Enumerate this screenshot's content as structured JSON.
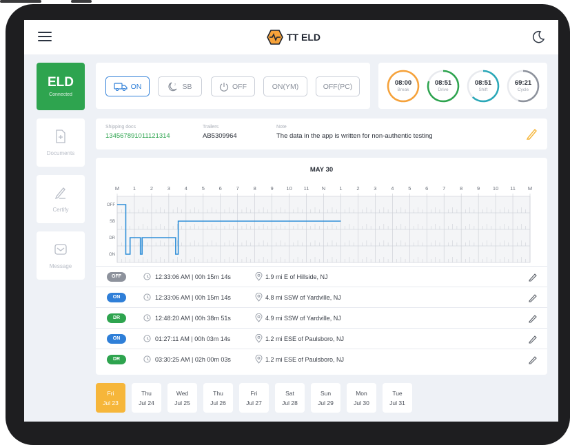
{
  "app": {
    "title": "TT ELD"
  },
  "colors": {
    "accent": "#2f7fd8",
    "green": "#2ea44f",
    "orange": "#f6a23a",
    "teal": "#2aa8b8",
    "gray": "#8d929c"
  },
  "eld": {
    "label": "ELD",
    "status": "Connected"
  },
  "sidebar": {
    "items": [
      {
        "label": "Documents",
        "icon": "document-plus-icon"
      },
      {
        "label": "Certify",
        "icon": "pen-icon"
      },
      {
        "label": "Message",
        "icon": "envelope-icon"
      }
    ]
  },
  "status_buttons": [
    {
      "label": "ON",
      "icon": "truck-icon",
      "active": true
    },
    {
      "label": "SB",
      "icon": "sleep-icon",
      "active": false
    },
    {
      "label": "OFF",
      "icon": "power-icon",
      "active": false
    },
    {
      "label": "ON(YM)",
      "active": false
    },
    {
      "label": "OFF(PC)",
      "active": false
    }
  ],
  "timers": [
    {
      "value": "08:00",
      "label": "Break",
      "color": "#f6a23a",
      "progress": 1.0
    },
    {
      "value": "08:51",
      "label": "Drive",
      "color": "#2ea44f",
      "progress": 0.8
    },
    {
      "value": "08:51",
      "label": "Shift",
      "color": "#2aa8b8",
      "progress": 0.62
    },
    {
      "value": "69:21",
      "label": "Cycle",
      "color": "#8d929c",
      "progress": 0.55
    }
  ],
  "info": {
    "shipping_label": "Shipping docs",
    "shipping_value": "134567891011121314",
    "trailers_label": "Trailers",
    "trailers_value": "AB5309964",
    "note_label": "Note",
    "note_value": "The data in the app is written for non-authentic testing"
  },
  "log": {
    "date": "MAY 30",
    "hour_labels": [
      "M",
      "1",
      "2",
      "3",
      "4",
      "5",
      "6",
      "7",
      "8",
      "9",
      "10",
      "11",
      "N",
      "1",
      "2",
      "3",
      "4",
      "5",
      "6",
      "7",
      "8",
      "9",
      "10",
      "11",
      "M"
    ],
    "status_labels": [
      "OFF",
      "SB",
      "DR",
      "ON"
    ],
    "segments": [
      {
        "status": "OFF",
        "start": 0.0,
        "end": 0.5
      },
      {
        "status": "ON",
        "start": 0.5,
        "end": 0.75
      },
      {
        "status": "DR",
        "start": 0.75,
        "end": 1.35
      },
      {
        "status": "ON",
        "start": 1.35,
        "end": 1.45
      },
      {
        "status": "DR",
        "start": 1.45,
        "end": 3.4
      },
      {
        "status": "ON",
        "start": 3.4,
        "end": 3.55
      },
      {
        "status": "SB",
        "start": 3.55,
        "end": 13.0
      }
    ],
    "entries": [
      {
        "status": "OFF",
        "color": "#8d929c",
        "time": "12:33:06 AM | 00h 15m 14s",
        "location": "1.9 mi E of Hillside, NJ"
      },
      {
        "status": "ON",
        "color": "#2f7fd8",
        "time": "12:33:06 AM | 00h 15m 14s",
        "location": "4.8 mi SSW of Yardville, NJ"
      },
      {
        "status": "DR",
        "color": "#2ea44f",
        "time": "12:48:20 AM | 00h 38m 51s",
        "location": "4.9 mi SSW of Yardville, NJ"
      },
      {
        "status": "ON",
        "color": "#2f7fd8",
        "time": "01:27:11 AM | 00h 03m 14s",
        "location": "1.2 mi ESE of Paulsboro, NJ"
      },
      {
        "status": "DR",
        "color": "#2ea44f",
        "time": "03:30:25 AM | 02h 00m 03s",
        "location": "1.2 mi ESE of Paulsboro, NJ"
      }
    ]
  },
  "days": [
    {
      "weekday": "Fri",
      "date": "Jul 23",
      "active": true
    },
    {
      "weekday": "Thu",
      "date": "Jul 24",
      "active": false
    },
    {
      "weekday": "Wed",
      "date": "Jul 25",
      "active": false
    },
    {
      "weekday": "Thu",
      "date": "Jul 26",
      "active": false
    },
    {
      "weekday": "Fri",
      "date": "Jul 27",
      "active": false
    },
    {
      "weekday": "Sat",
      "date": "Jul 28",
      "active": false
    },
    {
      "weekday": "Sun",
      "date": "Jul 29",
      "active": false
    },
    {
      "weekday": "Mon",
      "date": "Jul 30",
      "active": false
    },
    {
      "weekday": "Tue",
      "date": "Jul 31",
      "active": false
    }
  ]
}
